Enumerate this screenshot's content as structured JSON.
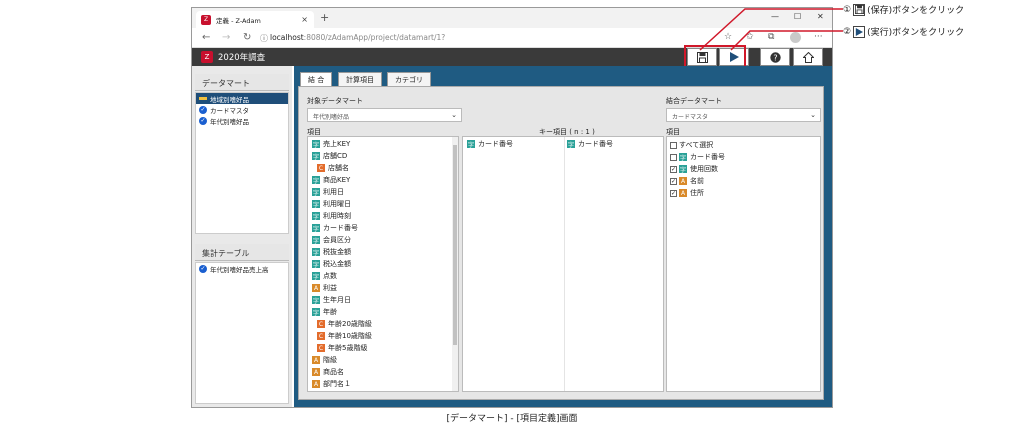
{
  "browser": {
    "tab_title": "定義 - Z-Adam",
    "url_host": "localhost",
    "url_path": ":8080/zAdamApp/project/datamart/1?"
  },
  "app": {
    "title": "2020年調査"
  },
  "left": {
    "datamart_heading": "データマート",
    "datamart_items": [
      "地域別嗜好品",
      "カードマスタ",
      "年代別嗜好品"
    ],
    "table_heading": "集計テーブル",
    "table_items": [
      "年代別嗜好品売上高"
    ]
  },
  "tabs": [
    "結 合",
    "計算項目",
    "カテゴリ"
  ],
  "target": {
    "label": "対象データマート",
    "select_value": "年代別嗜好品",
    "fields_label": "項目",
    "fields": [
      {
        "type": "t",
        "name": "売上KEY"
      },
      {
        "type": "t",
        "name": "店舗CD"
      },
      {
        "type": "c",
        "name": "店舗名"
      },
      {
        "type": "t",
        "name": "商品KEY"
      },
      {
        "type": "t",
        "name": "利用日"
      },
      {
        "type": "t",
        "name": "利用曜日"
      },
      {
        "type": "t",
        "name": "利用時刻"
      },
      {
        "type": "t",
        "name": "カード番号"
      },
      {
        "type": "t",
        "name": "会員区分"
      },
      {
        "type": "t",
        "name": "税抜金額"
      },
      {
        "type": "t",
        "name": "税込金額"
      },
      {
        "type": "t",
        "name": "点数"
      },
      {
        "type": "a",
        "name": "利益"
      },
      {
        "type": "t",
        "name": "生年月日"
      },
      {
        "type": "t",
        "name": "年齢"
      },
      {
        "type": "c",
        "name": "年齢20歳階級"
      },
      {
        "type": "c",
        "name": "年齢10歳階級"
      },
      {
        "type": "c",
        "name": "年齢5歳階級"
      },
      {
        "type": "a",
        "name": "階級"
      },
      {
        "type": "a",
        "name": "商品名"
      },
      {
        "type": "a",
        "name": "部門名１"
      }
    ]
  },
  "key": {
    "label": "キー項目 ( n : 1 )",
    "left": "カード番号",
    "right": "カード番号"
  },
  "join": {
    "label": "結合データマート",
    "select_value": "カードマスタ",
    "fields_label": "項目",
    "select_all": "すべて選択",
    "fields": [
      {
        "type": "t",
        "name": "カード番号",
        "checked": false
      },
      {
        "type": "t",
        "name": "使用回数",
        "checked": true
      },
      {
        "type": "a",
        "name": "名前",
        "checked": true
      },
      {
        "type": "a",
        "name": "住所",
        "checked": true
      }
    ]
  },
  "callouts": {
    "save": {
      "num": "①",
      "text": "(保存)ボタンをクリック"
    },
    "run": {
      "num": "②",
      "text": "(実行)ボタンをクリック"
    }
  },
  "caption": "[データマート] - [項目定義]画面",
  "colors": {
    "accent": "#d0182a",
    "main_bg": "#1f5b82",
    "appbar": "#3a3a3a"
  }
}
